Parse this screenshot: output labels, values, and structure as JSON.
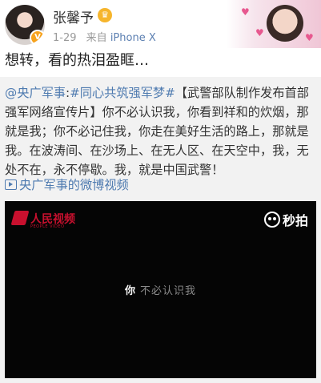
{
  "post": {
    "username": "张馨予",
    "date": "1-29",
    "source_prefix": "来自",
    "source_device": "iPhone X",
    "text": "想转，看的热泪盈眶…"
  },
  "repost": {
    "author": "@央广军事",
    "separator": ":",
    "topic": "#同心共筑强军梦#",
    "body": "【武警部队制作发布首部强军网络宣传片】你不必认识我，你看到祥和的炊烟，那就是我；你不必记住我，你走在美好生活的路上，那就是我。在波涛间、在沙场上、在无人区、在天空中，我，无处不在，永不停歇。我，就是中国武警！",
    "video_link_label": "央广军事的微博视频"
  },
  "video": {
    "brand_text": "人民视频",
    "brand_sub": "PEOPLE VIDEO",
    "miaopai_label": "秒拍",
    "subtitle_bright": "你",
    "subtitle_dim": "不必认识我"
  },
  "colors": {
    "link": "#4f7bb0",
    "repost_bg": "#f2f2f2",
    "video_bg": "#050505",
    "brand_red": "#c8102e"
  }
}
